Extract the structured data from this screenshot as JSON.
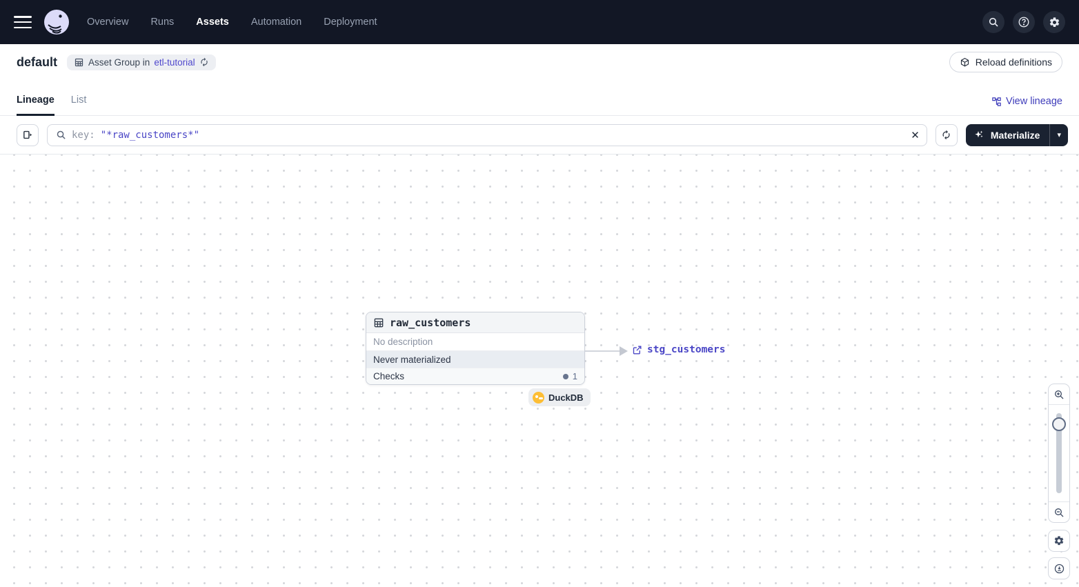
{
  "nav": {
    "items": [
      {
        "label": "Overview"
      },
      {
        "label": "Runs"
      },
      {
        "label": "Assets"
      },
      {
        "label": "Automation"
      },
      {
        "label": "Deployment"
      }
    ]
  },
  "header": {
    "title": "default",
    "badge": {
      "prefix": "Asset Group in",
      "link": "etl-tutorial"
    },
    "reload_label": "Reload definitions"
  },
  "tabs": {
    "lineage": "Lineage",
    "list": "List",
    "view_lineage": "View lineage"
  },
  "toolbar": {
    "filter_key": "key:",
    "filter_value": "\"*raw_customers*\"",
    "materialize_label": "Materialize"
  },
  "graph": {
    "node": {
      "title": "raw_customers",
      "description": "No description",
      "status": "Never materialized",
      "checks_label": "Checks",
      "checks_count": "1",
      "kind": "DuckDB"
    },
    "downstream": {
      "label": "stg_customers"
    }
  },
  "icons": {
    "clear": "✕",
    "caret_down": "▾",
    "help": "?"
  },
  "colors": {
    "accent_link": "#4a46c6",
    "nav_background": "#121725",
    "materialize_background": "#1a2231",
    "duckdb_yellow": "#fdbe35",
    "status_row_background": "#e9edf2"
  }
}
